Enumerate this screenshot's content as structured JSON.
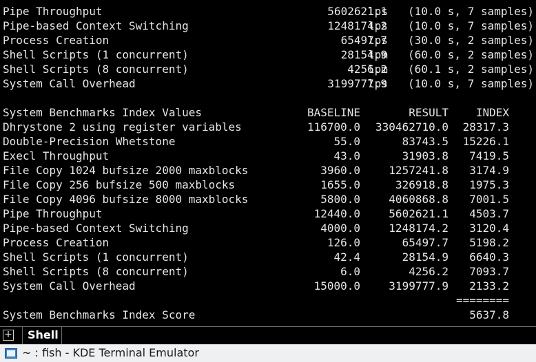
{
  "terminal": {
    "perf_rows": [
      {
        "label": "Pipe Throughput",
        "value": "5602621.1",
        "unit": "lps",
        "detail": "(10.0 s, 7 samples)"
      },
      {
        "label": "Pipe-based Context Switching",
        "value": "1248174.2",
        "unit": "lps",
        "detail": "(10.0 s, 7 samples)"
      },
      {
        "label": "Process Creation",
        "value": "65497.7",
        "unit": "lps",
        "detail": "(30.0 s, 2 samples)"
      },
      {
        "label": "Shell Scripts (1 concurrent)",
        "value": "28154.9",
        "unit": "lpm",
        "detail": "(60.0 s, 2 samples)"
      },
      {
        "label": "Shell Scripts (8 concurrent)",
        "value": "4256.2",
        "unit": "lpm",
        "detail": "(60.1 s, 2 samples)"
      },
      {
        "label": "System Call Overhead",
        "value": "3199777.9",
        "unit": "lps",
        "detail": "(10.0 s, 7 samples)"
      }
    ],
    "index_header": {
      "label": "System Benchmarks Index Values",
      "baseline": "BASELINE",
      "result": "RESULT",
      "index": "INDEX"
    },
    "index_rows": [
      {
        "label": "Dhrystone 2 using register variables",
        "baseline": "116700.0",
        "result": "330462710.0",
        "index": "28317.3"
      },
      {
        "label": "Double-Precision Whetstone",
        "baseline": "55.0",
        "result": "83743.5",
        "index": "15226.1"
      },
      {
        "label": "Execl Throughput",
        "baseline": "43.0",
        "result": "31903.8",
        "index": "7419.5"
      },
      {
        "label": "File Copy 1024 bufsize 2000 maxblocks",
        "baseline": "3960.0",
        "result": "1257241.8",
        "index": "3174.9"
      },
      {
        "label": "File Copy 256 bufsize 500 maxblocks",
        "baseline": "1655.0",
        "result": "326918.8",
        "index": "1975.3"
      },
      {
        "label": "File Copy 4096 bufsize 8000 maxblocks",
        "baseline": "5800.0",
        "result": "4060868.8",
        "index": "7001.5"
      },
      {
        "label": "Pipe Throughput",
        "baseline": "12440.0",
        "result": "5602621.1",
        "index": "4503.7"
      },
      {
        "label": "Pipe-based Context Switching",
        "baseline": "4000.0",
        "result": "1248174.2",
        "index": "3120.4"
      },
      {
        "label": "Process Creation",
        "baseline": "126.0",
        "result": "65497.7",
        "index": "5198.2"
      },
      {
        "label": "Shell Scripts (1 concurrent)",
        "baseline": "42.4",
        "result": "28154.9",
        "index": "6640.3"
      },
      {
        "label": "Shell Scripts (8 concurrent)",
        "baseline": "6.0",
        "result": "4256.2",
        "index": "7093.7"
      },
      {
        "label": "System Call Overhead",
        "baseline": "15000.0",
        "result": "3199777.9",
        "index": "2133.2"
      }
    ],
    "separator": "========",
    "score": {
      "label": "System Benchmarks Index Score",
      "value": "5637.8"
    }
  },
  "tabbar": {
    "new_tab_glyph": "+",
    "tab_label": "Shell"
  },
  "taskbar": {
    "title": "~ : fish - KDE Terminal Emulator",
    "icon": "terminal-icon"
  }
}
